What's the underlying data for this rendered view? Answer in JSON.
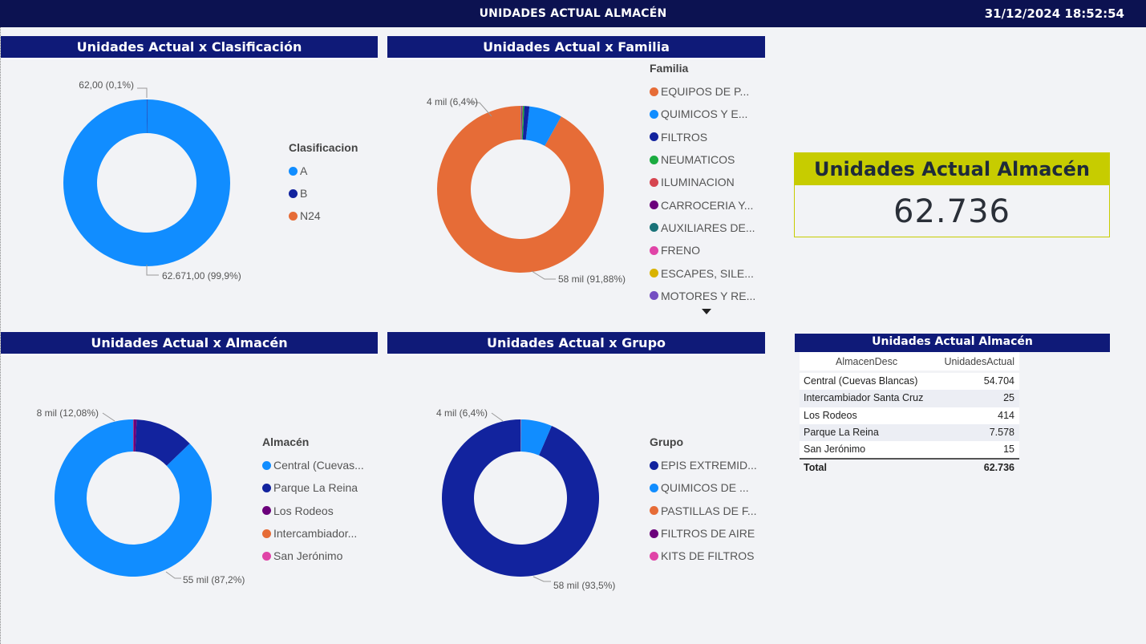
{
  "header": {
    "title": "UNIDADES ACTUAL ALMACÉN",
    "datetime": "31/12/2024 18:52:54"
  },
  "panels": {
    "clasificacion": {
      "title": "Unidades Actual x Clasificación"
    },
    "familia": {
      "title": "Unidades Actual x Familia"
    },
    "almacen": {
      "title": "Unidades Actual x Almacén"
    },
    "grupo": {
      "title": "Unidades Actual x Grupo"
    }
  },
  "kpi": {
    "title": "Unidades Actual Almacén",
    "value": "62.736"
  },
  "table": {
    "title": "Unidades Actual Almacén",
    "columns": [
      "AlmacenDesc",
      "UnidadesActual"
    ],
    "rows": [
      [
        "Central (Cuevas Blancas)",
        "54.704"
      ],
      [
        "Intercambiador Santa Cruz",
        "25"
      ],
      [
        "Los Rodeos",
        "414"
      ],
      [
        "Parque La Reina",
        "7.578"
      ],
      [
        "San Jerónimo",
        "15"
      ]
    ],
    "total": [
      "Total",
      "62.736"
    ]
  },
  "chart_data": [
    {
      "id": "clasificacion",
      "type": "pie",
      "legend_title": "Clasificacion",
      "categories": [
        "A",
        "B",
        "N24"
      ],
      "values": [
        62671,
        62,
        3
      ],
      "colors": [
        "#118dff",
        "#12239e",
        "#e66c37"
      ],
      "data_labels": [
        {
          "index": 1,
          "text": "62,00 (0,1%)"
        },
        {
          "index": 0,
          "text": "62.671,00 (99,9%)"
        }
      ]
    },
    {
      "id": "familia",
      "type": "pie",
      "legend_title": "Familia",
      "categories": [
        "EQUIPOS DE P...",
        "QUIMICOS Y E...",
        "FILTROS",
        "NEUMATICOS",
        "ILUMINACION",
        "CARROCERIA Y...",
        "AUXILIARES DE...",
        "FRENO",
        "ESCAPES, SILE...",
        "MOTORES Y RE..."
      ],
      "values": [
        91.88,
        6.4,
        1.0,
        0.3,
        0.15,
        0.1,
        0.07,
        0.04,
        0.03,
        0.03
      ],
      "colors": [
        "#e66c37",
        "#118dff",
        "#12239e",
        "#1aab40",
        "#d64550",
        "#6b007b",
        "#197278",
        "#e044a7",
        "#d9b300",
        "#744ec2"
      ],
      "data_labels": [
        {
          "index": 1,
          "text": "4 mil (6,4%)"
        },
        {
          "index": 0,
          "text": "58 mil (91,88%)"
        }
      ]
    },
    {
      "id": "almacen",
      "type": "pie",
      "legend_title": "Almacén",
      "categories": [
        "Central (Cuevas...",
        "Parque La Reina",
        "Los Rodeos",
        "Intercambiador...",
        "San Jerónimo"
      ],
      "values": [
        54704,
        7578,
        414,
        25,
        15
      ],
      "colors": [
        "#118dff",
        "#12239e",
        "#6b007b",
        "#e66c37",
        "#e044a7"
      ],
      "data_labels": [
        {
          "index": 1,
          "text": "8 mil (12,08%)"
        },
        {
          "index": 0,
          "text": "55 mil (87,2%)"
        }
      ]
    },
    {
      "id": "grupo",
      "type": "pie",
      "legend_title": "Grupo",
      "categories": [
        "EPIS EXTREMID...",
        "QUIMICOS DE ...",
        "PASTILLAS DE F...",
        "FILTROS DE AIRE",
        "KITS DE FILTROS"
      ],
      "values": [
        93.5,
        6.4,
        0.05,
        0.03,
        0.02
      ],
      "colors": [
        "#12239e",
        "#118dff",
        "#e66c37",
        "#6b007b",
        "#e044a7"
      ],
      "data_labels": [
        {
          "index": 1,
          "text": "4 mil (6,4%)"
        },
        {
          "index": 0,
          "text": "58 mil (93,5%)"
        }
      ]
    }
  ]
}
